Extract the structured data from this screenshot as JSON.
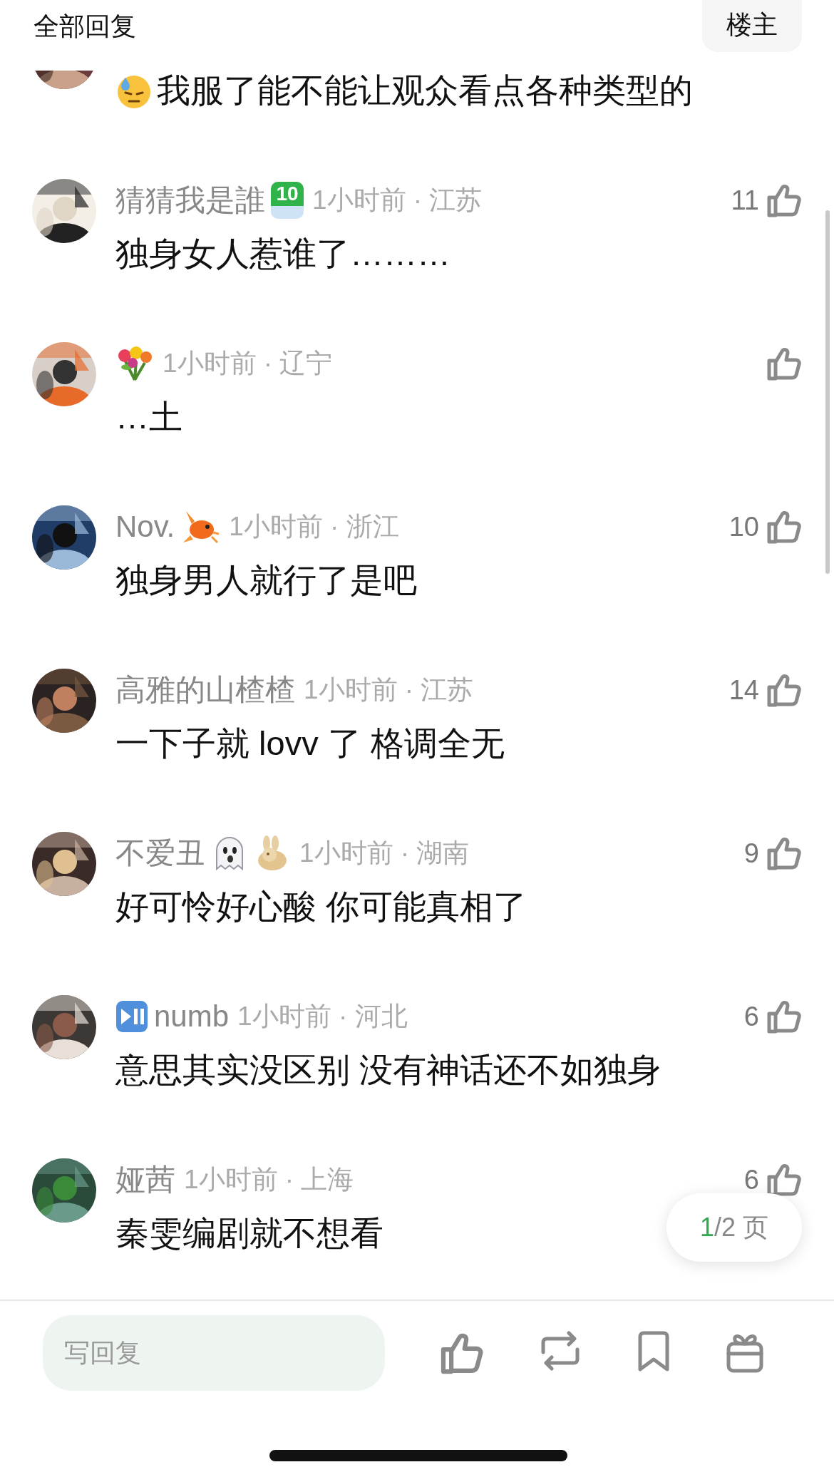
{
  "header": {
    "title": "全部回复",
    "author_button": "楼主"
  },
  "comments": [
    {
      "kind": "clipped",
      "text_icons": [
        {
          "kind": "sweat-face"
        }
      ],
      "text": "我服了能不能让观众看点各种类型的"
    },
    {
      "kind": "reply",
      "name": "猜猜我是誰",
      "badge": "10",
      "time": "1小时前 · 江苏",
      "likes": "11",
      "text": "独身女人惹谁了………"
    },
    {
      "kind": "reply",
      "name_icons_after": [
        {
          "kind": "bouquet"
        }
      ],
      "time": "1小时前 · 辽宁",
      "text": "…土"
    },
    {
      "kind": "reply",
      "name": "Nov.",
      "name_icons_after": [
        {
          "kind": "fish"
        }
      ],
      "time": "1小时前 · 浙江",
      "likes": "10",
      "text": "独身男人就行了是吧"
    },
    {
      "kind": "reply",
      "name": "高雅的山楂楂",
      "time": "1小时前 · 江苏",
      "likes": "14",
      "text": "一下子就 lovv 了 格调全无"
    },
    {
      "kind": "reply",
      "name": "不爱丑",
      "name_icons_after": [
        {
          "kind": "ghost"
        },
        {
          "kind": "rabbit"
        }
      ],
      "time": "1小时前 · 湖南",
      "likes": "9",
      "text": "好可怜好心酸 你可能真相了"
    },
    {
      "kind": "reply",
      "name_icons_before": [
        {
          "kind": "play-pause"
        }
      ],
      "name": "numb",
      "time": "1小时前 · 河北",
      "likes": "6",
      "text": "意思其实没区别 没有神话还不如独身"
    },
    {
      "kind": "reply",
      "name": "娅茜",
      "time": "1小时前 · 上海",
      "likes": "6",
      "text": "秦雯编剧就不想看"
    }
  ],
  "pager": {
    "current": "1",
    "total": "/2 页"
  },
  "reply_bar": {
    "placeholder": "写回复"
  }
}
